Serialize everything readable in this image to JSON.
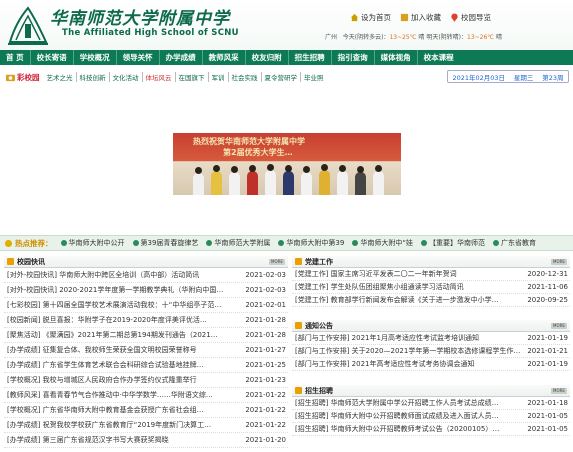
{
  "header": {
    "school_cn": "华南师范大学附属中学",
    "school_en": "The Affiliated High School of SCNU",
    "links": [
      {
        "label": "设为首页",
        "icon": "home-icon"
      },
      {
        "label": "加入收藏",
        "icon": "star-icon"
      },
      {
        "label": "校园导览",
        "icon": "location-icon"
      }
    ],
    "weather": {
      "city": "广州",
      "today_label": "今天(阴转多云)：",
      "today_temp": "13~25℃",
      "tomorrow_label": "晴 明天(阴转晴)：",
      "tomorrow_temp": "13~26℃",
      "tail": " 晴"
    }
  },
  "nav": [
    "首 页",
    "校长寄语",
    "学校概况",
    "领导关怀",
    "办学成绩",
    "教师风采",
    "校友归附",
    "招生招聘",
    "指引查询",
    "媒体视角",
    "校本课程"
  ],
  "subbar": {
    "title": "彩校园",
    "links": [
      "艺术之光",
      "科技创新",
      "文化活动",
      "体坛风云",
      "在国旗下",
      "军训",
      "社会实践",
      "夏令营研学",
      "毕业照"
    ],
    "active_index": 3,
    "date": "2021年02月03日",
    "weekday": "星期三",
    "week": "第23周"
  },
  "banner": {
    "line1": "热烈祝贺华南师范大学附属中学",
    "line2": "第2届优秀大学生…"
  },
  "hotbar": {
    "label": "热点推荐：",
    "items": [
      "华南师大附中公开",
      "第39届青春旋律艺",
      "华南师范大学附属",
      "华南师大附中第39",
      "华南师大附中“娃",
      "【重要】华南师范",
      "广东省教育"
    ]
  },
  "left_panel": {
    "title": "校园快讯",
    "rows": [
      {
        "text": "[对外-校园快讯] 华南师大附中跨区全培训（高中部）活动简讯",
        "date": "2021-02-03"
      },
      {
        "text": "[对外-校园快讯] 2020-2021学年度第一学期教学典礼（华附向中国…",
        "date": "2021-02-03"
      },
      {
        "text": "[七彩校园] 第十四届全国学校艺术展演活动我校：十“中华组亭子范…",
        "date": "2021-02-01"
      },
      {
        "text": "[校园新闻] 脱旦喜报：华附学子在2019-2020年度评美评优活…",
        "date": "2021-01-28"
      },
      {
        "text": "[聚焦活动] 《聚满园》2021年第二期总第194期发刊通告（2021…",
        "date": "2021-01-28"
      },
      {
        "text": "[办学成绩] 征集复合体、我校师生荣获全国文明校园荣誉称号",
        "date": "2021-01-27"
      },
      {
        "text": "[办学成绩] 广东省学生体育艺术联合会科研综合试验基地挂牌…",
        "date": "2021-01-25"
      },
      {
        "text": "[学校概况] 我校与增城区人民政府合作办学签约仪式隆重举行",
        "date": "2021-01-23"
      },
      {
        "text": "[教师风采] 喜看青春节气合作推动中‧中华学数学……华附语文综…",
        "date": "2021-01-22"
      },
      {
        "text": "[学校概况] 广东省华南师大附中教育基金会获授广东省社会组…",
        "date": "2021-01-22"
      },
      {
        "text": "[办学成绩] 祝贺我校学校获广东省教育厅“2019年度新门决算工…",
        "date": "2021-01-22"
      },
      {
        "text": "[办学成绩] 第三届广东省规范汉字书写大赛获奖揭晓",
        "date": "2021-01-20"
      }
    ]
  },
  "right_panels": [
    {
      "title": "党建工作",
      "rows": [
        {
          "text": "[党建工作] 国家主席习近平发表二〇二一年新年贺词",
          "date": "2020-12-31"
        },
        {
          "text": "[党建工作] 学生处队伍团组聚焦小组通读学习活动简讯",
          "date": "2021-11-06"
        },
        {
          "text": "[党建工作] 教育部学行新闻发布会解读《关于进一步激发中小学…",
          "date": "2020-09-25"
        }
      ]
    },
    {
      "title": "通知公告",
      "rows": [
        {
          "text": "[部门与工作安排] 2021年1月高考适应性考试监考培训通知",
          "date": "2021-01-19"
        },
        {
          "text": "[部门与工作安排] 关于2020—2021学年第一学期校本选修课程学生作…",
          "date": "2021-01-21"
        },
        {
          "text": "[部门与工作安排] 2021年高考适应性考试考务协调会通知",
          "date": "2021-01-19"
        }
      ]
    },
    {
      "title": "招生招聘",
      "rows": [
        {
          "text": "[招生招聘] 华南师范大学附属中学公开招聘工作人员考试总成绩…",
          "date": "2021-01-18"
        },
        {
          "text": "[招生招聘] 华南师大附中公开招聘教师面试成绩及进入面试人员…",
          "date": "2021-01-05"
        },
        {
          "text": "[招生招聘] 华南师大附中公开招聘教师考试公告（20200105）…",
          "date": "2021-01-05"
        }
      ]
    }
  ],
  "colors": {
    "nav_green": "#0e7a55",
    "title_green": "#0d6a4a",
    "accent_orange": "#e8a000"
  }
}
